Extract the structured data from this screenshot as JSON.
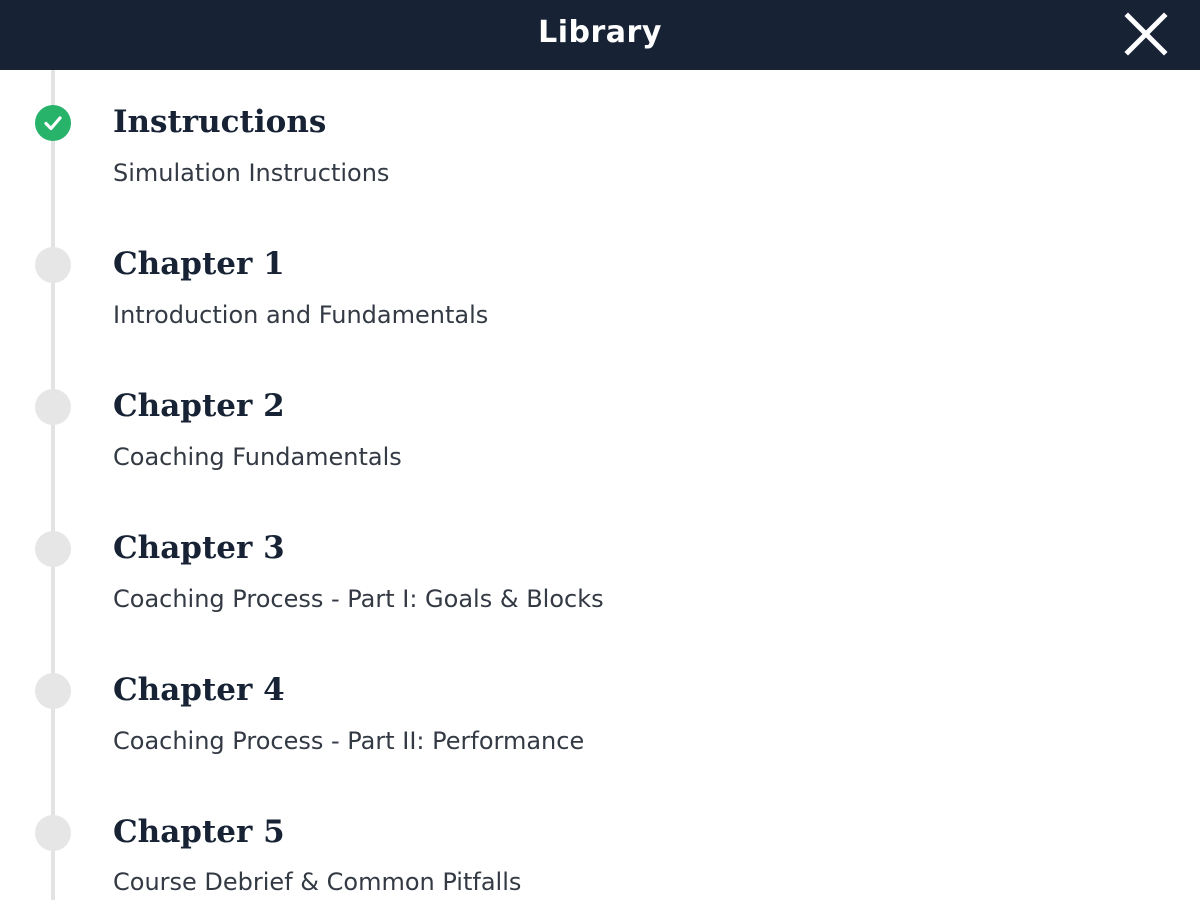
{
  "header": {
    "title": "Library",
    "close_icon": "close-icon"
  },
  "colors": {
    "header_bg": "#172335",
    "completed": "#27b36a",
    "pending": "#e6e6e6",
    "timeline": "#e3e3e3"
  },
  "items": [
    {
      "title": "Instructions",
      "subtitle": "Simulation Instructions",
      "status": "completed"
    },
    {
      "title": "Chapter 1",
      "subtitle": "Introduction and Fundamentals",
      "status": "pending"
    },
    {
      "title": "Chapter 2",
      "subtitle": "Coaching Fundamentals",
      "status": "pending"
    },
    {
      "title": "Chapter 3",
      "subtitle": "Coaching Process - Part I: Goals & Blocks",
      "status": "pending"
    },
    {
      "title": "Chapter 4",
      "subtitle": "Coaching Process - Part II: Performance",
      "status": "pending"
    },
    {
      "title": "Chapter 5",
      "subtitle": "Course Debrief & Common Pitfalls",
      "status": "pending"
    }
  ]
}
